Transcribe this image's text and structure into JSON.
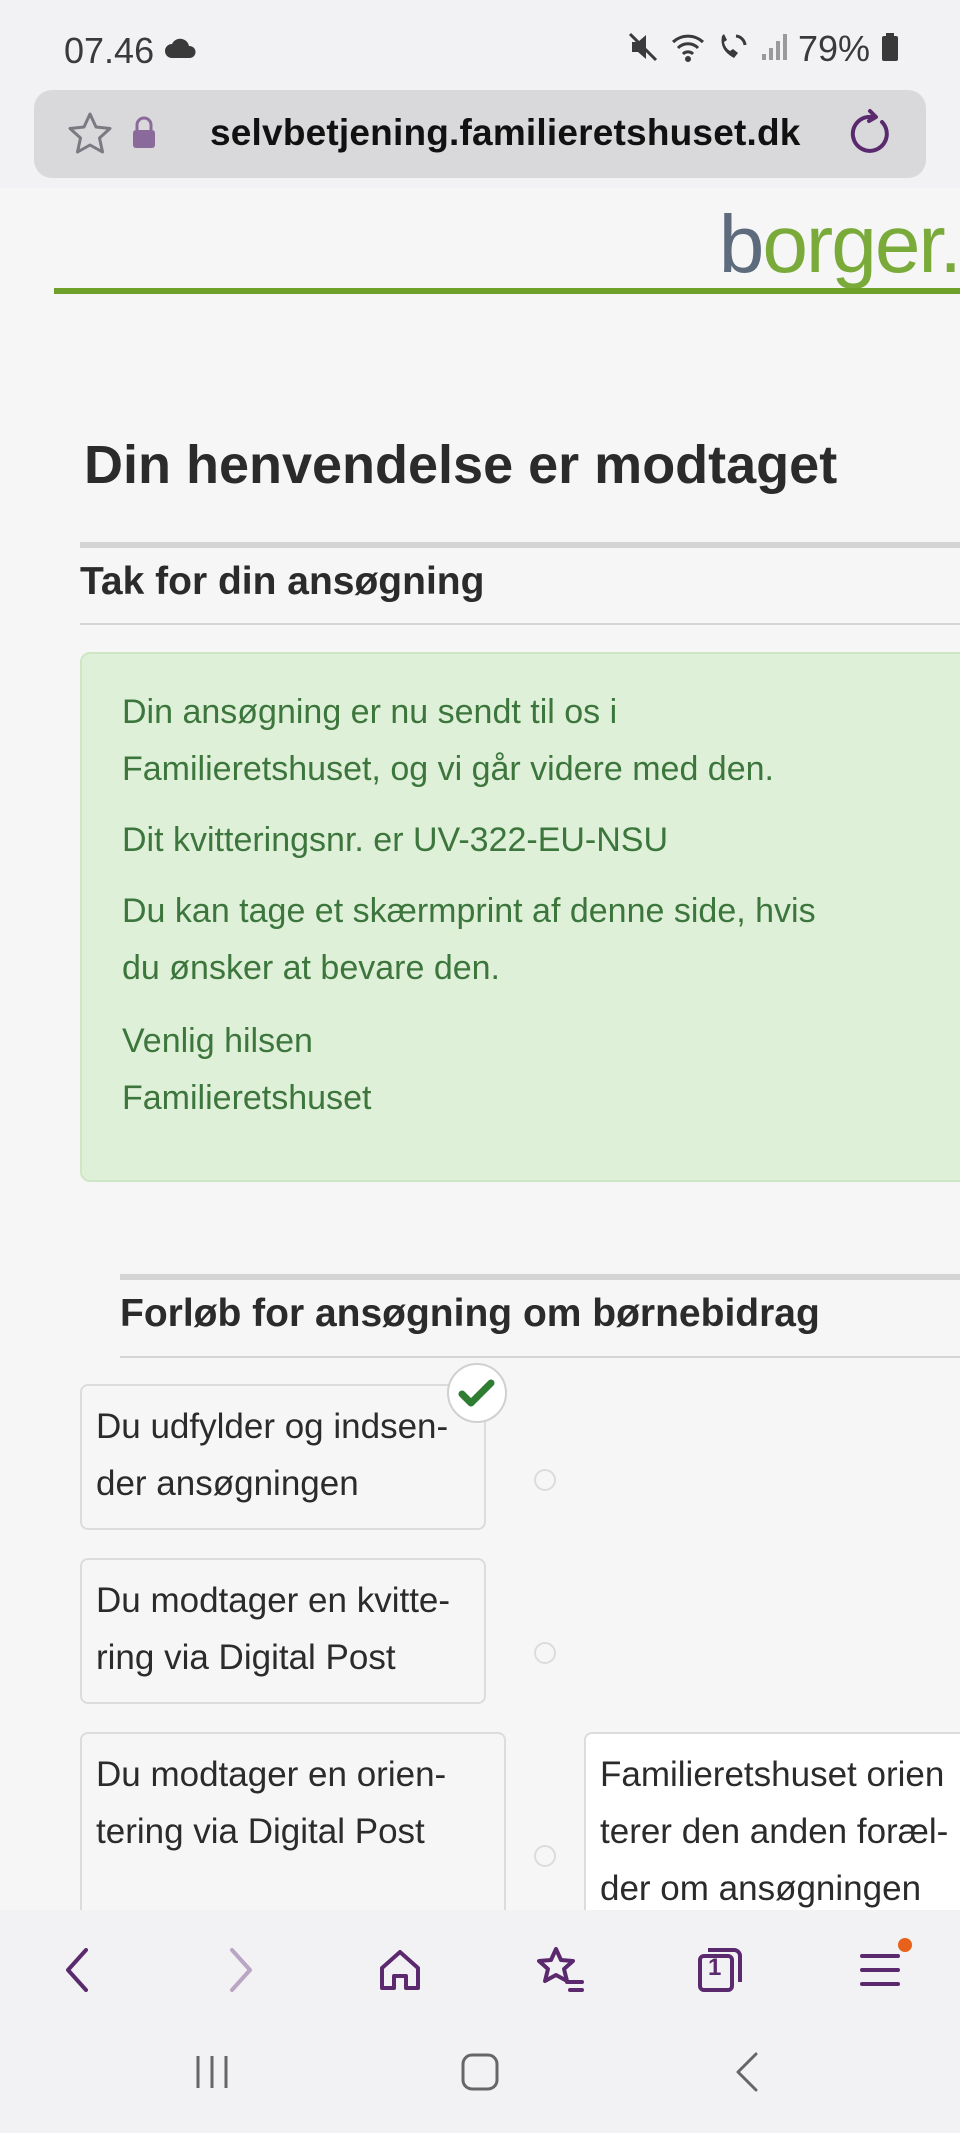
{
  "status_bar": {
    "time": "07.46",
    "battery": "79%"
  },
  "browser": {
    "url": "selvbetjening.familieretshuset.dk",
    "tab_count": "1"
  },
  "site": {
    "logo_b": "b",
    "logo_rest": "orger."
  },
  "main": {
    "title": "Din henvendelse er modtaget",
    "thanks_heading": "Tak for din ansøgning",
    "message": {
      "line1": "Din ansøgning er nu sendt til os i",
      "line2": "Familieretshuset, og vi går videre med den.",
      "receipt": "Dit kvitteringsnr. er UV-322-EU-NSU",
      "line4": "Du kan tage et skærmprint af denne side, hvis",
      "line5": "du ønsker at bevare den.",
      "greeting": "Venlig hilsen",
      "signature": "Familieretshuset"
    },
    "process_heading": "Forløb for ansøgning om børnebidrag",
    "steps": [
      {
        "line1": "Du udfylder og indsen-",
        "line2": "der ansøgningen"
      },
      {
        "line1": "Du modtager en kvitte-",
        "line2": "ring via Digital Post"
      },
      {
        "line1": "Du modtager en orien-",
        "line2": "tering via Digital Post"
      },
      {
        "line1": "Familieretshuset orien",
        "line2": "terer den anden foræl-",
        "line3": "der om ansøgningen"
      }
    ]
  },
  "colors": {
    "accent_green": "#6ea02a",
    "success_text": "#3c763d",
    "success_bg": "#dff0d8",
    "browser_icon": "#5b2a6e"
  }
}
